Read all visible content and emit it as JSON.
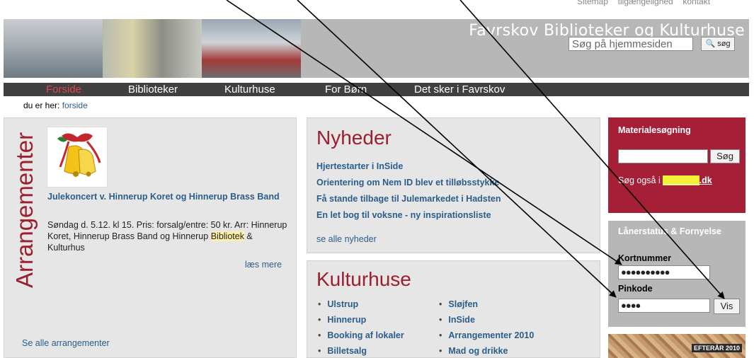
{
  "util": {
    "sitemap": "Sitemap",
    "accessibility": "tilgængelighed",
    "contact": "kontakt"
  },
  "header": {
    "site_title": "Favrskov Biblioteker og Kulturhuse"
  },
  "search": {
    "placeholder": "Søg på hjemmesiden",
    "button": "søg"
  },
  "nav": [
    {
      "label": "Forside",
      "active": true
    },
    {
      "label": "Biblioteker"
    },
    {
      "label": "Kulturhuse"
    },
    {
      "label": "For Børn"
    },
    {
      "label": "Det sker i Favrskov"
    }
  ],
  "breadcrumb": {
    "prefix": "du er her:",
    "current": "forside"
  },
  "events": {
    "heading": "Arrangementer",
    "title": "Julekoncert v. Hinnerup Koret og Hinnerup Brass Band",
    "desc_part1": "Søndag d. 5.12. kl 15. Pris: forsalg/entre: 50 kr. Arr: Hinnerup Koret, Hinnerup Brass Band og Hinnerup ",
    "desc_highlight": "Bibliotek",
    "desc_part2": " & Kulturhus",
    "read_more": "læs mere",
    "see_all": "Se alle arrangementer"
  },
  "news": {
    "title": "Nyheder",
    "items": [
      "Hjertestarter i InSide",
      "Orientering om Nem ID blev et tilløbsstykke",
      "Få stande tilbage til Julemarkedet i Hadsten",
      "En let bog til voksne - ny inspirationsliste"
    ],
    "see_all": "se alle nyheder"
  },
  "culture": {
    "title": "Kulturhuse",
    "col1": [
      "Ulstrup",
      "Hinnerup",
      "Booking af lokaler",
      "Billetsalg"
    ],
    "col2": [
      "Sløjfen",
      "InSide",
      "Arrangementer 2010",
      "Mad og drikke"
    ]
  },
  "material": {
    "title": "Materialesøgning",
    "button": "Søg",
    "also_prefix": "Søg også i ",
    "also_link_highlight": "bibliotek",
    "also_link_suffix": ".dk"
  },
  "loan": {
    "title": "Lånerstatus & Fornyelse",
    "card_label": "Kortnummer",
    "card_value": "●●●●●●●●●●",
    "pin_label": "Pinkode",
    "pin_value": "●●●●",
    "button": "Vis"
  },
  "banner": {
    "label": "EFTERÅR 2010"
  },
  "colors": {
    "accent": "#a51f36",
    "nav": "#404040",
    "link": "#2b5d8c",
    "header": "#b7b7b7"
  }
}
